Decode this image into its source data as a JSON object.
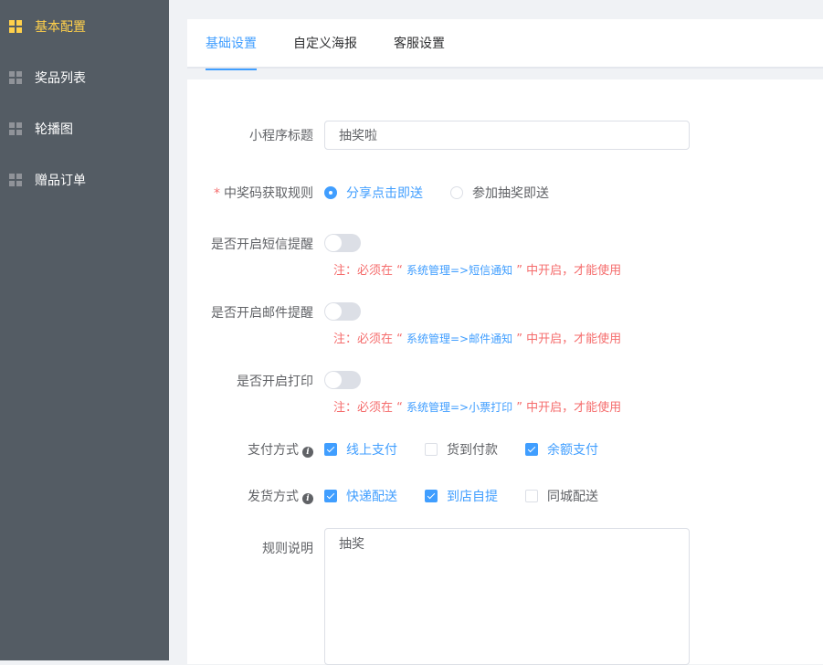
{
  "sidebar": {
    "items": [
      {
        "label": "基本配置",
        "active": true
      },
      {
        "label": "奖品列表"
      },
      {
        "label": "轮播图"
      },
      {
        "label": "赠品订单"
      }
    ]
  },
  "tabs": [
    {
      "label": "基础设置",
      "active": true
    },
    {
      "label": "自定义海报"
    },
    {
      "label": "客服设置"
    }
  ],
  "form": {
    "title_label": "小程序标题",
    "title_value": "抽奖啦",
    "rule_required": "*",
    "rule_label": "中奖码获取规则",
    "rule_options": [
      "分享点击即送",
      "参加抽奖即送"
    ],
    "sms_label": "是否开启短信提醒",
    "sms_note_prefix": "注：必须在 “ ",
    "sms_note_link": "系统管理=>短信通知",
    "sms_note_suffix": " ” 中开启，才能使用",
    "email_label": "是否开启邮件提醒",
    "email_note_prefix": "注：必须在 “ ",
    "email_note_link": "系统管理=>邮件通知",
    "email_note_suffix": " ” 中开启，才能使用",
    "print_label": "是否开启打印",
    "print_note_prefix": "注：必须在 “ ",
    "print_note_link": "系统管理=>小票打印",
    "print_note_suffix": " ” 中开启，才能使用",
    "pay_label": "支付方式",
    "pay_options": [
      {
        "label": "线上支付",
        "checked": true
      },
      {
        "label": "货到付款",
        "checked": false
      },
      {
        "label": "余额支付",
        "checked": true
      }
    ],
    "ship_label": "发货方式",
    "ship_options": [
      {
        "label": "快递配送",
        "checked": true
      },
      {
        "label": "到店自提",
        "checked": true
      },
      {
        "label": "同城配送",
        "checked": false
      }
    ],
    "rules_label": "规则说明",
    "rules_value": "抽奖"
  },
  "icons": {
    "menu": "grid-icon",
    "info": "info-icon"
  },
  "colors": {
    "sidebar_bg": "#545c64",
    "sidebar_active": "#ffd04b",
    "primary": "#409eff",
    "danger": "#f56c6c"
  }
}
